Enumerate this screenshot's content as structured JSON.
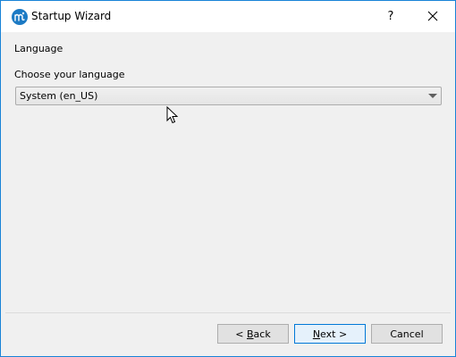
{
  "window": {
    "title": "Startup Wizard",
    "help_label": "?",
    "close_icon": "close-icon",
    "app_icon": "musescore-app-icon",
    "accent_color": "#1883d7"
  },
  "page": {
    "section_title": "Language",
    "prompt": "Choose your language",
    "language_select": {
      "selected": "System (en_US)"
    }
  },
  "footer": {
    "back_label": "Back",
    "back_mnemonic": "B",
    "next_label": "Next",
    "next_mnemonic": "N",
    "cancel_label": "Cancel"
  }
}
